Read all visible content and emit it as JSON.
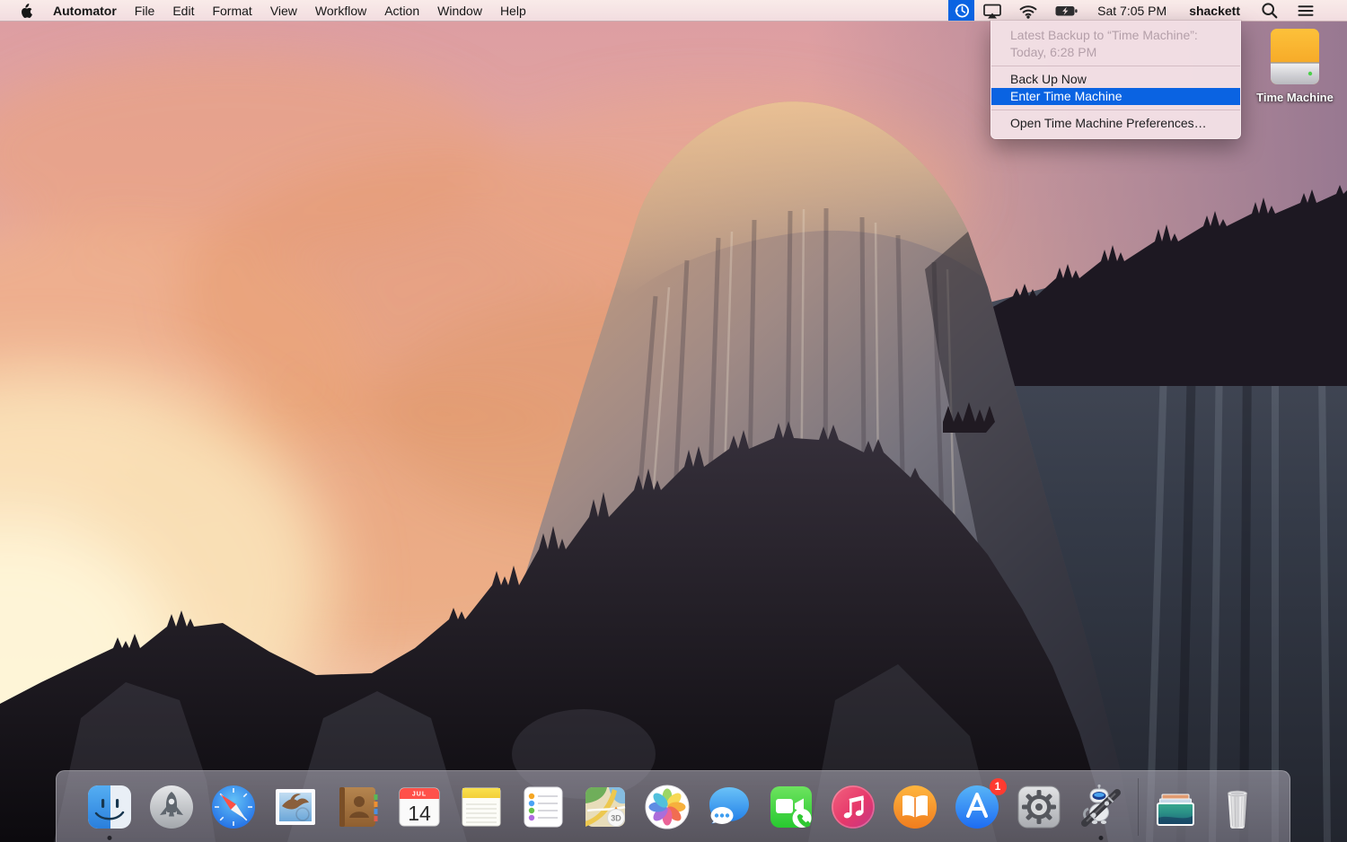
{
  "menu_bar": {
    "apple_icon": "apple-logo-icon",
    "app_name": "Automator",
    "menus": [
      "File",
      "Edit",
      "Format",
      "View",
      "Workflow",
      "Action",
      "Window",
      "Help"
    ],
    "status_icons": [
      "time-machine-icon",
      "airplay-icon",
      "wifi-icon",
      "battery-charging-icon",
      "spotlight-search-icon",
      "notification-center-icon"
    ],
    "clock": "Sat 7:05 PM",
    "username": "shackett"
  },
  "time_machine_menu": {
    "latest_backup_line1": "Latest Backup to “Time Machine”:",
    "latest_backup_line2": "Today, 6:28 PM",
    "back_up_now": "Back Up Now",
    "enter_time_machine": "Enter Time Machine",
    "open_preferences": "Open Time Machine Preferences…",
    "highlight_color": "#0a63e2"
  },
  "desktop": {
    "time_machine_icon_label": "Time Machine"
  },
  "dock": {
    "items": [
      "finder",
      "launchpad",
      "safari",
      "mail",
      "contacts",
      "calendar",
      "notes",
      "reminders",
      "maps",
      "photos",
      "messages",
      "facetime",
      "itunes",
      "ibooks",
      "app-store",
      "system-preferences",
      "automator",
      "separator",
      "desktop-pictures-stack",
      "trash"
    ],
    "running": [
      "finder",
      "automator"
    ],
    "calendar": {
      "month": "JUL",
      "day": "14"
    },
    "maps_3d_label": "3D",
    "app_store_badge": "1"
  },
  "colors": {
    "menu_bar_bg": "#f5e2e3",
    "dropdown_bg": "#f3e0e5",
    "menu_highlight": "#0a63e2",
    "dock_bg": "#9a97a8"
  }
}
